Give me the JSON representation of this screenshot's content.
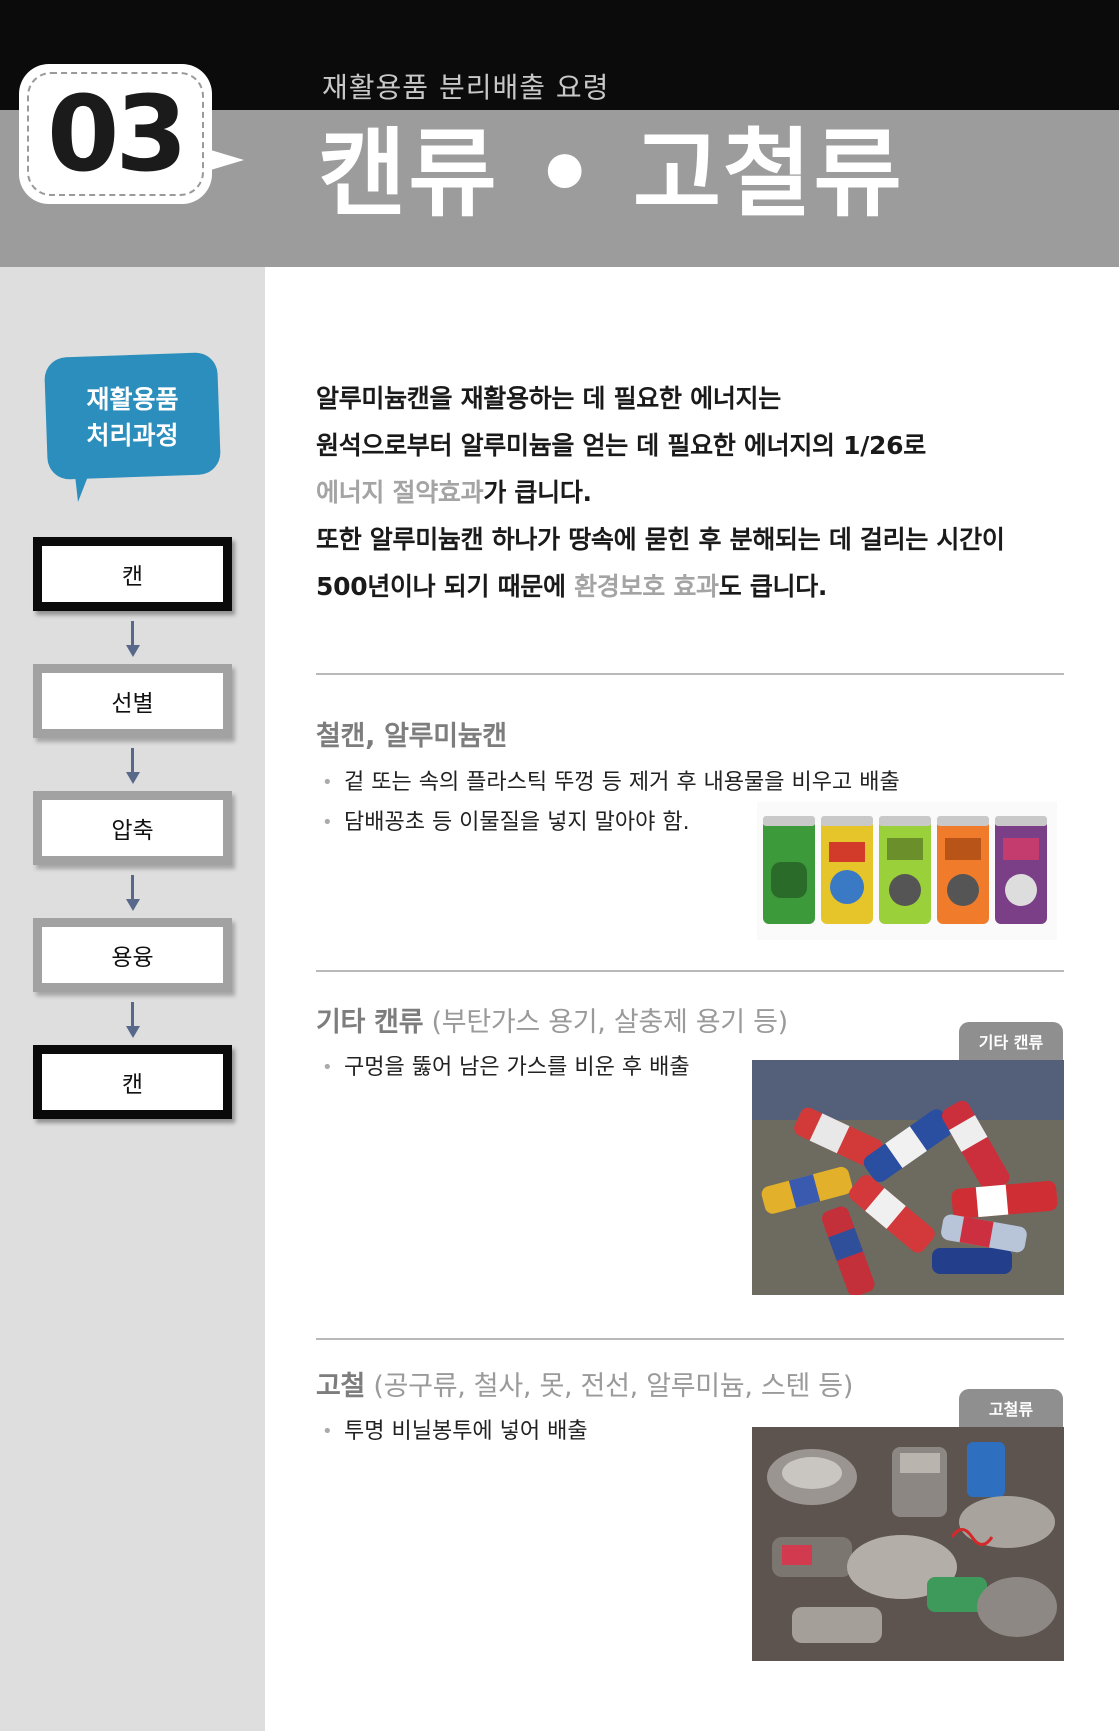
{
  "header": {
    "number": "03",
    "subtitle": "재활용품 분리배출 요령",
    "title": "캔류 • 고철류"
  },
  "sidebar": {
    "bubble_line1": "재활용품",
    "bubble_line2": "처리과정",
    "steps": [
      "캔",
      "선별",
      "압축",
      "용융",
      "캔"
    ]
  },
  "intro": {
    "line1": "알루미늄캔을 재활용하는 데 필요한 에너지는",
    "line2": "원석으로부터 알루미늄을 얻는 데 필요한 에너지의 1/26로",
    "line3_highlight": "에너지 절약효과",
    "line3_rest": "가 큽니다.",
    "line4": "또한 알루미늄캔 하나가 땅속에 묻힌 후 분해되는 데 걸리는 시간이",
    "line5_start": "500년이나 되기 때문에 ",
    "line5_highlight": "환경보호 효과",
    "line5_rest": "도 큽니다."
  },
  "sections": [
    {
      "title": "철캔, 알루미늄캔",
      "title_detail": "",
      "bullets": [
        "겉 또는 속의 플라스틱 뚜껑 등 제거 후 내용물을 비우고 배출",
        "담배꽁초 등 이물질을 넣지 말아야 함."
      ],
      "photo_label": ""
    },
    {
      "title": "기타 캔류",
      "title_detail": " (부탄가스 용기, 살충제 용기 등)",
      "bullets": [
        "구멍을 뚫어 남은 가스를 비운 후 배출"
      ],
      "photo_label": "기타 캔류"
    },
    {
      "title": "고철",
      "title_detail": " (공구류, 철사, 못, 전선, 알루미늄, 스텐 등)",
      "bullets": [
        "투명 비닐봉투에 넣어 배출"
      ],
      "photo_label": "고철류"
    }
  ],
  "colors": {
    "header_black": "#0b0b0b",
    "header_gray": "#9c9c9c",
    "sidebar_bg": "#dedede",
    "bubble_blue": "#2b8ebd",
    "highlight_gray": "#a4a4a4",
    "arrow": "#57688a"
  }
}
